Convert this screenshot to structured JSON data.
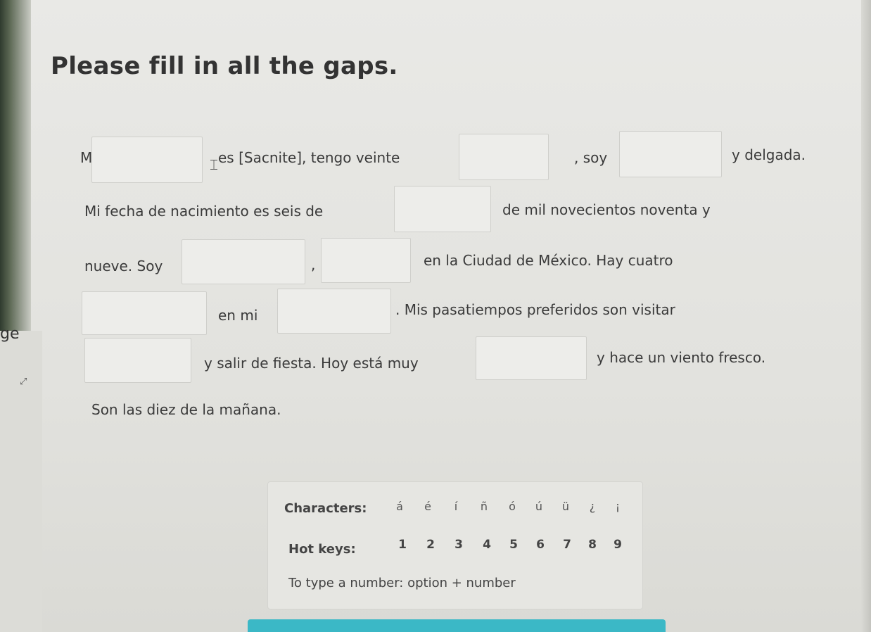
{
  "title": "Please fill in all the gaps.",
  "text": {
    "t1": "Mi",
    "t2": "es [Sacnite], tengo veinte",
    "t3": ", soy",
    "t4": "y delgada.",
    "t5": "Mi fecha de nacimiento es seis de",
    "t6": "de mil novecientos noventa y",
    "t7": "nueve. Soy",
    "t8": ",",
    "t9": "en la Ciudad de México. Hay cuatro",
    "t10": "en mi",
    "t11": ". Mis pasatiempos preferidos son visitar",
    "t12": "y salir de fiesta. Hoy está muy",
    "t13": "y hace un viento fresco.",
    "t14": "Son las diez de la mañana."
  },
  "gaps": [
    "",
    "",
    "",
    "",
    "",
    "",
    "",
    "",
    "",
    ""
  ],
  "edge_text": "ge",
  "panel": {
    "characters_label": "Characters:",
    "characters": [
      "á",
      "é",
      "í",
      "ñ",
      "ó",
      "ú",
      "ü",
      "¿",
      "¡"
    ],
    "hotkeys_label": "Hot keys:",
    "hotkeys": [
      "1",
      "2",
      "3",
      "4",
      "5",
      "6",
      "7",
      "8",
      "9"
    ],
    "note": "To type a number: option + number"
  },
  "colors": {
    "accent": "#3bb8c6",
    "background": "#e4e4e0"
  }
}
